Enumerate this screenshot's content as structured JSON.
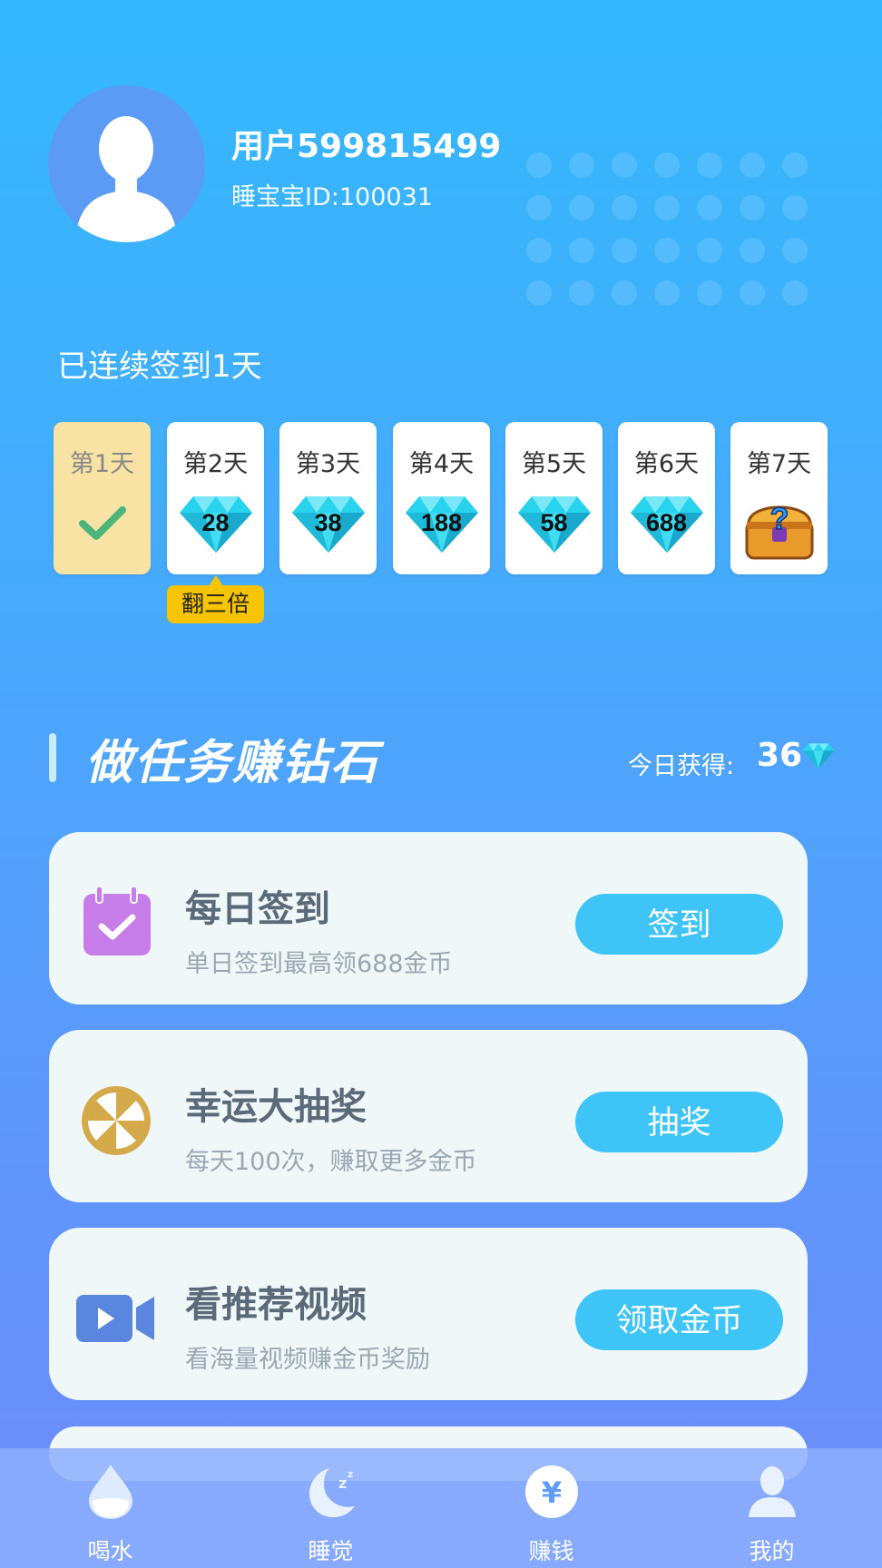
{
  "profile": {
    "username": "用户599815499",
    "user_id": "睡宝宝ID:100031"
  },
  "checkin": {
    "streak_text": "已连续签到1天",
    "days": [
      {
        "label": "第1天",
        "status": "checked",
        "icon": "check-icon"
      },
      {
        "label": "第2天",
        "reward": "28",
        "icon": "diamond-icon"
      },
      {
        "label": "第3天",
        "reward": "38",
        "icon": "diamond-icon"
      },
      {
        "label": "第4天",
        "reward": "188",
        "icon": "diamond-icon"
      },
      {
        "label": "第5天",
        "reward": "58",
        "icon": "diamond-icon"
      },
      {
        "label": "第6天",
        "reward": "688",
        "icon": "diamond-icon"
      },
      {
        "label": "第7天",
        "icon": "mystery-chest-icon"
      }
    ],
    "bonus_badge": "翻三倍"
  },
  "tasks_section": {
    "title": "做任务赚钻石",
    "today_label": "今日获得:",
    "today_value": "36"
  },
  "tasks": [
    {
      "title": "每日签到",
      "subtitle": "单日签到最高领688金币",
      "button": "签到",
      "icon": "calendar-check-icon",
      "icon_color": "#c77de8"
    },
    {
      "title": "幸运大抽奖",
      "subtitle": "每天100次，赚取更多金币",
      "button": "抽奖",
      "icon": "lottery-wheel-icon",
      "icon_color": "#d4a94a"
    },
    {
      "title": "看推荐视频",
      "subtitle": "看海量视频赚金币奖励",
      "button": "领取金币",
      "icon": "video-camera-icon",
      "icon_color": "#5b86e0"
    }
  ],
  "nav": [
    {
      "label": "喝水",
      "icon": "water-drop-icon",
      "active": false
    },
    {
      "label": "睡觉",
      "icon": "moon-sleep-icon",
      "active": false
    },
    {
      "label": "赚钱",
      "icon": "yuan-coin-icon",
      "active": true
    },
    {
      "label": "我的",
      "icon": "user-icon",
      "active": false
    }
  ],
  "colors": {
    "accent_button": "#3ec4f7",
    "badge": "#f7c500",
    "checked_card": "#f8e3a4",
    "diamond": "#28d3ee"
  }
}
